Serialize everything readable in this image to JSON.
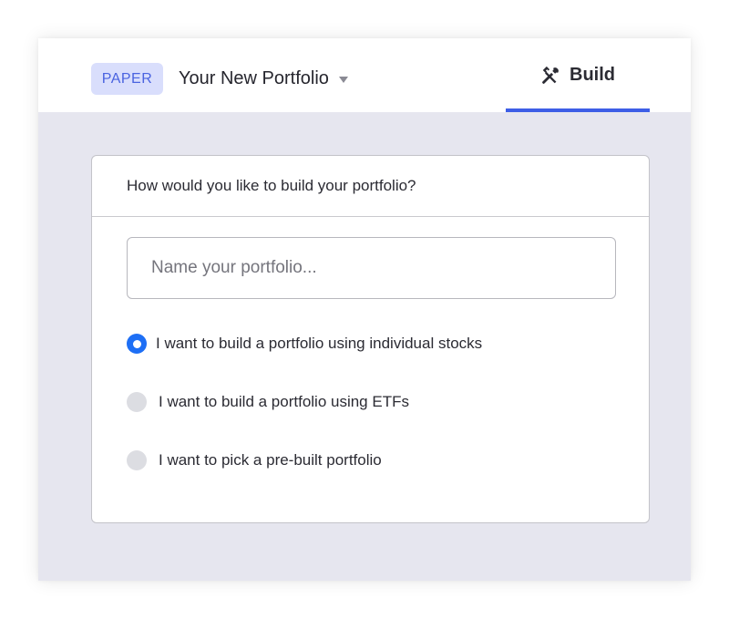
{
  "header": {
    "badge": "PAPER",
    "portfolio_title": "Your New Portfolio",
    "tab_build_label": "Build"
  },
  "card": {
    "question": "How would you like to build your portfolio?",
    "name_input": {
      "placeholder": "Name your portfolio...",
      "value": ""
    },
    "options": [
      {
        "label": "I want to build a portfolio using individual stocks",
        "selected": true
      },
      {
        "label": "I want to build a portfolio using ETFs",
        "selected": false
      },
      {
        "label": "I want to pick a pre-built portfolio",
        "selected": false
      }
    ]
  },
  "colors": {
    "accent": "#3e5ee6",
    "radio_selected": "#1e6ff5",
    "badge_bg": "#d9defc",
    "badge_text": "#4a63e0",
    "page_bg": "#e6e6ef"
  },
  "icons": {
    "build_tab": "hammer-wrench-icon",
    "portfolio_dropdown": "caret-down-icon"
  }
}
